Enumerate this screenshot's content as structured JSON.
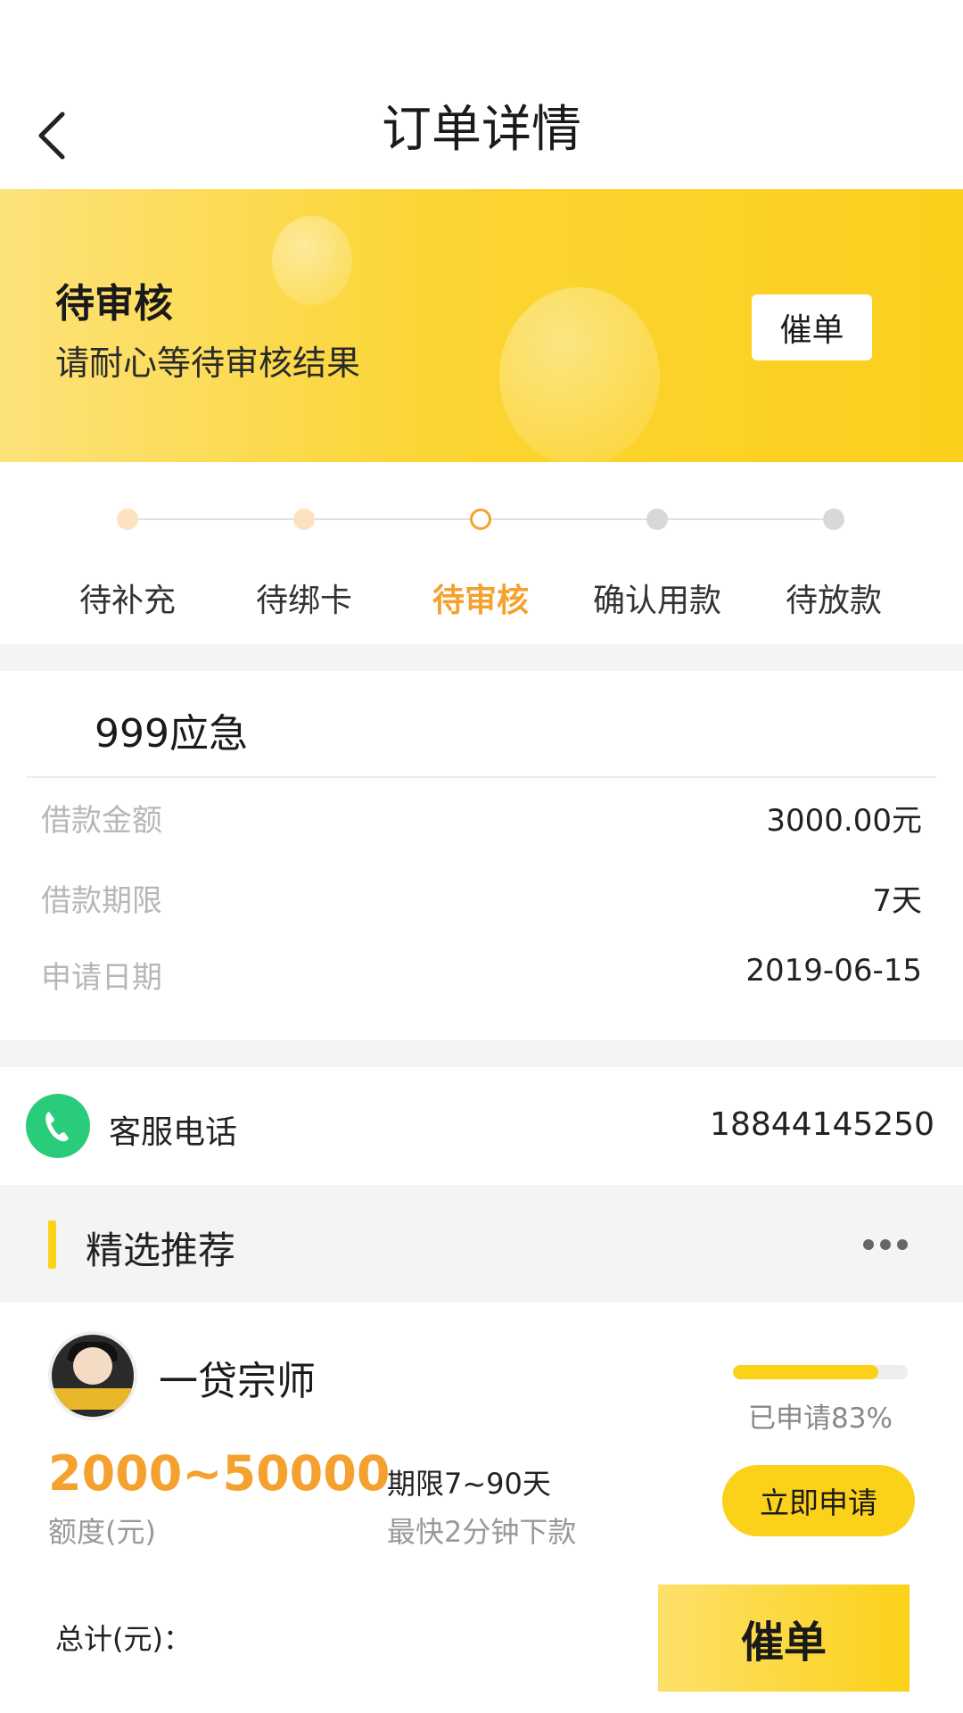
{
  "header": {
    "title": "订单详情",
    "back_icon": "chevron-left-icon"
  },
  "status": {
    "title": "待审核",
    "subtitle": "请耐心等待审核结果",
    "urge_label": "催单"
  },
  "steps": [
    {
      "label": "待补充",
      "state": "done"
    },
    {
      "label": "待绑卡",
      "state": "done"
    },
    {
      "label": "待审核",
      "state": "current"
    },
    {
      "label": "确认用款",
      "state": "todo"
    },
    {
      "label": "待放款",
      "state": "todo"
    }
  ],
  "order": {
    "product": "999应急",
    "rows": [
      {
        "label": "借款金额",
        "value": "3000.00元"
      },
      {
        "label": "借款期限",
        "value": "7天"
      },
      {
        "label": "申请日期",
        "value": "2019-06-15"
      }
    ]
  },
  "service": {
    "label": "客服电话",
    "phone": "18844145250",
    "icon": "phone-icon"
  },
  "recommend": {
    "title": "精选推荐",
    "more_icon": "more-dots-icon",
    "product": {
      "name": "一贷宗师",
      "applied_text": "已申请83%",
      "applied_fraction": 0.83,
      "amount": "2000~50000",
      "amount_label": "额度(元)",
      "term": "期限7~90天",
      "speed": "最快2分钟下款",
      "apply_label": "立即申请"
    }
  },
  "bottom": {
    "total_label": "总计(元)：",
    "urge_label": "催单"
  },
  "colors": {
    "brand_yellow": "#fcd11a",
    "accent_orange": "#f5a12f",
    "phone_green": "#29cc7a"
  }
}
